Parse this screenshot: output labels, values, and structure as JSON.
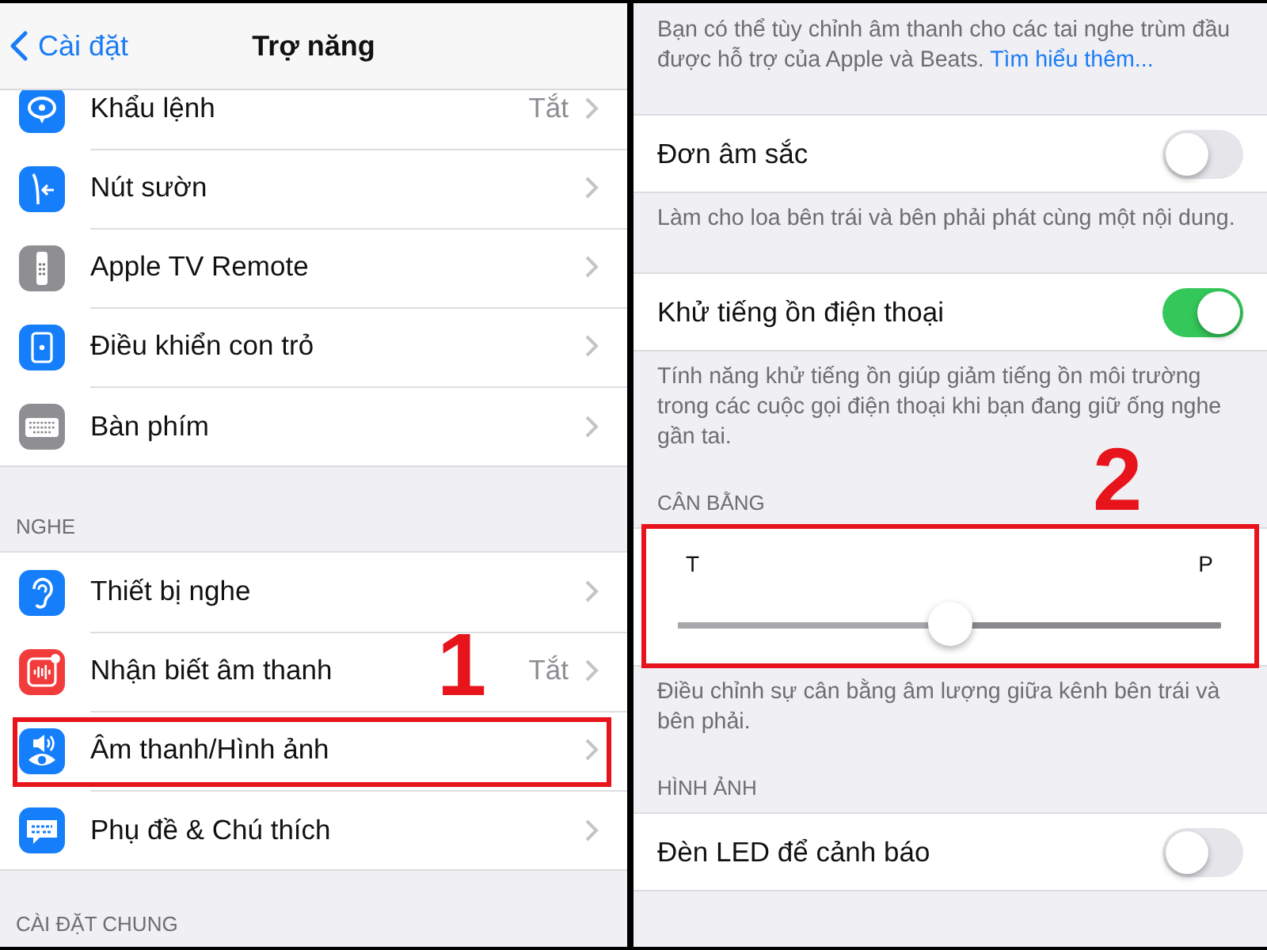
{
  "left_screen": {
    "nav": {
      "back": "Cài đặt",
      "title": "Trợ năng"
    },
    "groups": [
      {
        "items": [
          {
            "kind": "dictation",
            "label": "Khẩu lệnh",
            "value": "Tắt",
            "highlighted": false
          },
          {
            "kind": "side_button",
            "label": "Nút sườn",
            "highlighted": false
          },
          {
            "kind": "remote",
            "label": "Apple TV Remote",
            "highlighted": false
          },
          {
            "kind": "pointer",
            "label": "Điều khiển con trỏ",
            "highlighted": false
          },
          {
            "kind": "keyboard",
            "label": "Bàn phím",
            "highlighted": false
          }
        ]
      },
      {
        "header": "NGHE",
        "items": [
          {
            "kind": "hearing",
            "label": "Thiết bị nghe",
            "highlighted": false
          },
          {
            "kind": "sound_recognition",
            "label": "Nhận biết âm thanh",
            "value": "Tắt",
            "highlighted": false
          },
          {
            "kind": "audio_visual",
            "label": "Âm thanh/Hình ảnh",
            "highlighted": true,
            "callout": "1"
          },
          {
            "kind": "subtitles",
            "label": "Phụ đề & Chú thích",
            "highlighted": false
          }
        ]
      },
      {
        "header": "CÀI ĐẶT CHUNG"
      }
    ]
  },
  "right_screen": {
    "sections": [
      {
        "kind": "caption",
        "text": "Bạn có thể tùy chỉnh âm thanh cho các tai nghe trùm đầu được hỗ trợ của Apple và Beats.",
        "link": "Tìm hiểu thêm..."
      },
      {
        "kind": "toggle",
        "label": "Đơn âm sắc",
        "on": false
      },
      {
        "kind": "caption",
        "text": "Làm cho loa bên trái và bên phải phát cùng một nội dung."
      },
      {
        "kind": "toggle",
        "label": "Khử tiếng ồn điện thoại",
        "on": true
      },
      {
        "kind": "caption",
        "text": "Tính năng khử tiếng ồn giúp giảm tiếng ồn môi trường trong các cuộc gọi điện thoại khi bạn đang giữ ống nghe gần tai."
      },
      {
        "kind": "header",
        "text": "CÂN BẰNG"
      },
      {
        "kind": "slider",
        "min_label": "T",
        "max_label": "P",
        "level": 0.5,
        "highlighted": true,
        "callout": "2"
      },
      {
        "kind": "caption",
        "text": "Điều chỉnh sự cân bằng âm lượng giữa kênh bên trái và bên phải."
      },
      {
        "kind": "header",
        "text": "HÌNH ẢNH"
      },
      {
        "kind": "toggle",
        "label": "Đèn LED để cảnh báo",
        "on": false
      }
    ]
  }
}
